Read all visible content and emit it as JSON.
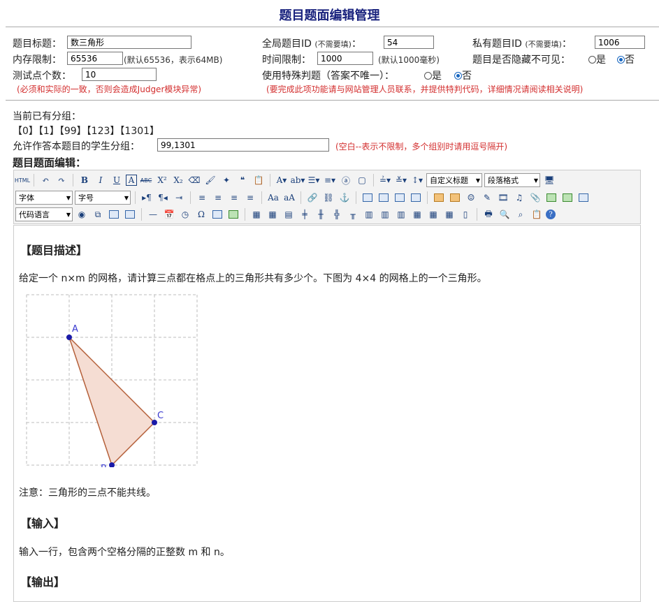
{
  "page_title": "题目题面编辑管理",
  "form": {
    "title_label": "题目标题：",
    "title_value": "数三角形",
    "global_id_label": "全局题目ID",
    "global_id_hint": "(不需要填)",
    "colon": "：",
    "global_id_value": "54",
    "private_id_label": "私有题目ID",
    "private_id_hint": "(不需要填)",
    "private_id_value": "1006",
    "memory_label": "内存限制：",
    "memory_value": "65536",
    "memory_hint": "(默认65536，表示64MB)",
    "time_label": "时间限制：",
    "time_value": "1000",
    "time_hint": "(默认1000毫秒)",
    "hidden_label": "题目是否隐藏不可见：",
    "hidden_yes": "是",
    "hidden_no": "否",
    "testcases_label": "测试点个数：",
    "testcases_value": "10",
    "testcases_warning": "(必须和实际的一致，否则会造成Judger模块异常)",
    "special_judge_label": "使用特殊判题（答案不唯一）：",
    "special_yes": "是",
    "special_no": "否",
    "special_judge_warning": "(要完成此项功能请与网站管理人员联系，并提供特判代码，详细情况请阅读相关说明)"
  },
  "groups": {
    "current_label": "当前已有分组：",
    "items": [
      "【0】",
      "【1】",
      "【99】",
      "【123】",
      "【1301】"
    ],
    "allowed_label": "允许作答本题目的学生分组：",
    "allowed_value": "99,1301",
    "allowed_hint": "(空白--表示不限制，多个组别时请用逗号隔开)"
  },
  "editor": {
    "section_label": "题目题面编辑：",
    "html_btn": "HTML",
    "custom_heading": "自定义标题",
    "paragraph_format": "段落格式",
    "font": "字体",
    "font_size": "字号",
    "code_lang": "代码语言"
  },
  "content": {
    "desc_heading": "【题目描述】",
    "desc_text": "给定一个 n×m 的网格，请计算三点都在格点上的三角形共有多少个。下图为 4×4 的网格上的一个三角形。",
    "point_labels": [
      "A",
      "B",
      "C"
    ],
    "note": "注意：三角形的三点不能共线。",
    "input_heading": "【输入】",
    "input_text": "输入一行，包含两个空格分隔的正整数 m 和 n。",
    "output_heading": "【输出】"
  },
  "colors": {
    "title": "#1a237e",
    "warning": "#d32f2f",
    "triangle_fill": "#f5ddd3",
    "triangle_stroke": "#b5603a",
    "point": "#1a1aa8"
  }
}
